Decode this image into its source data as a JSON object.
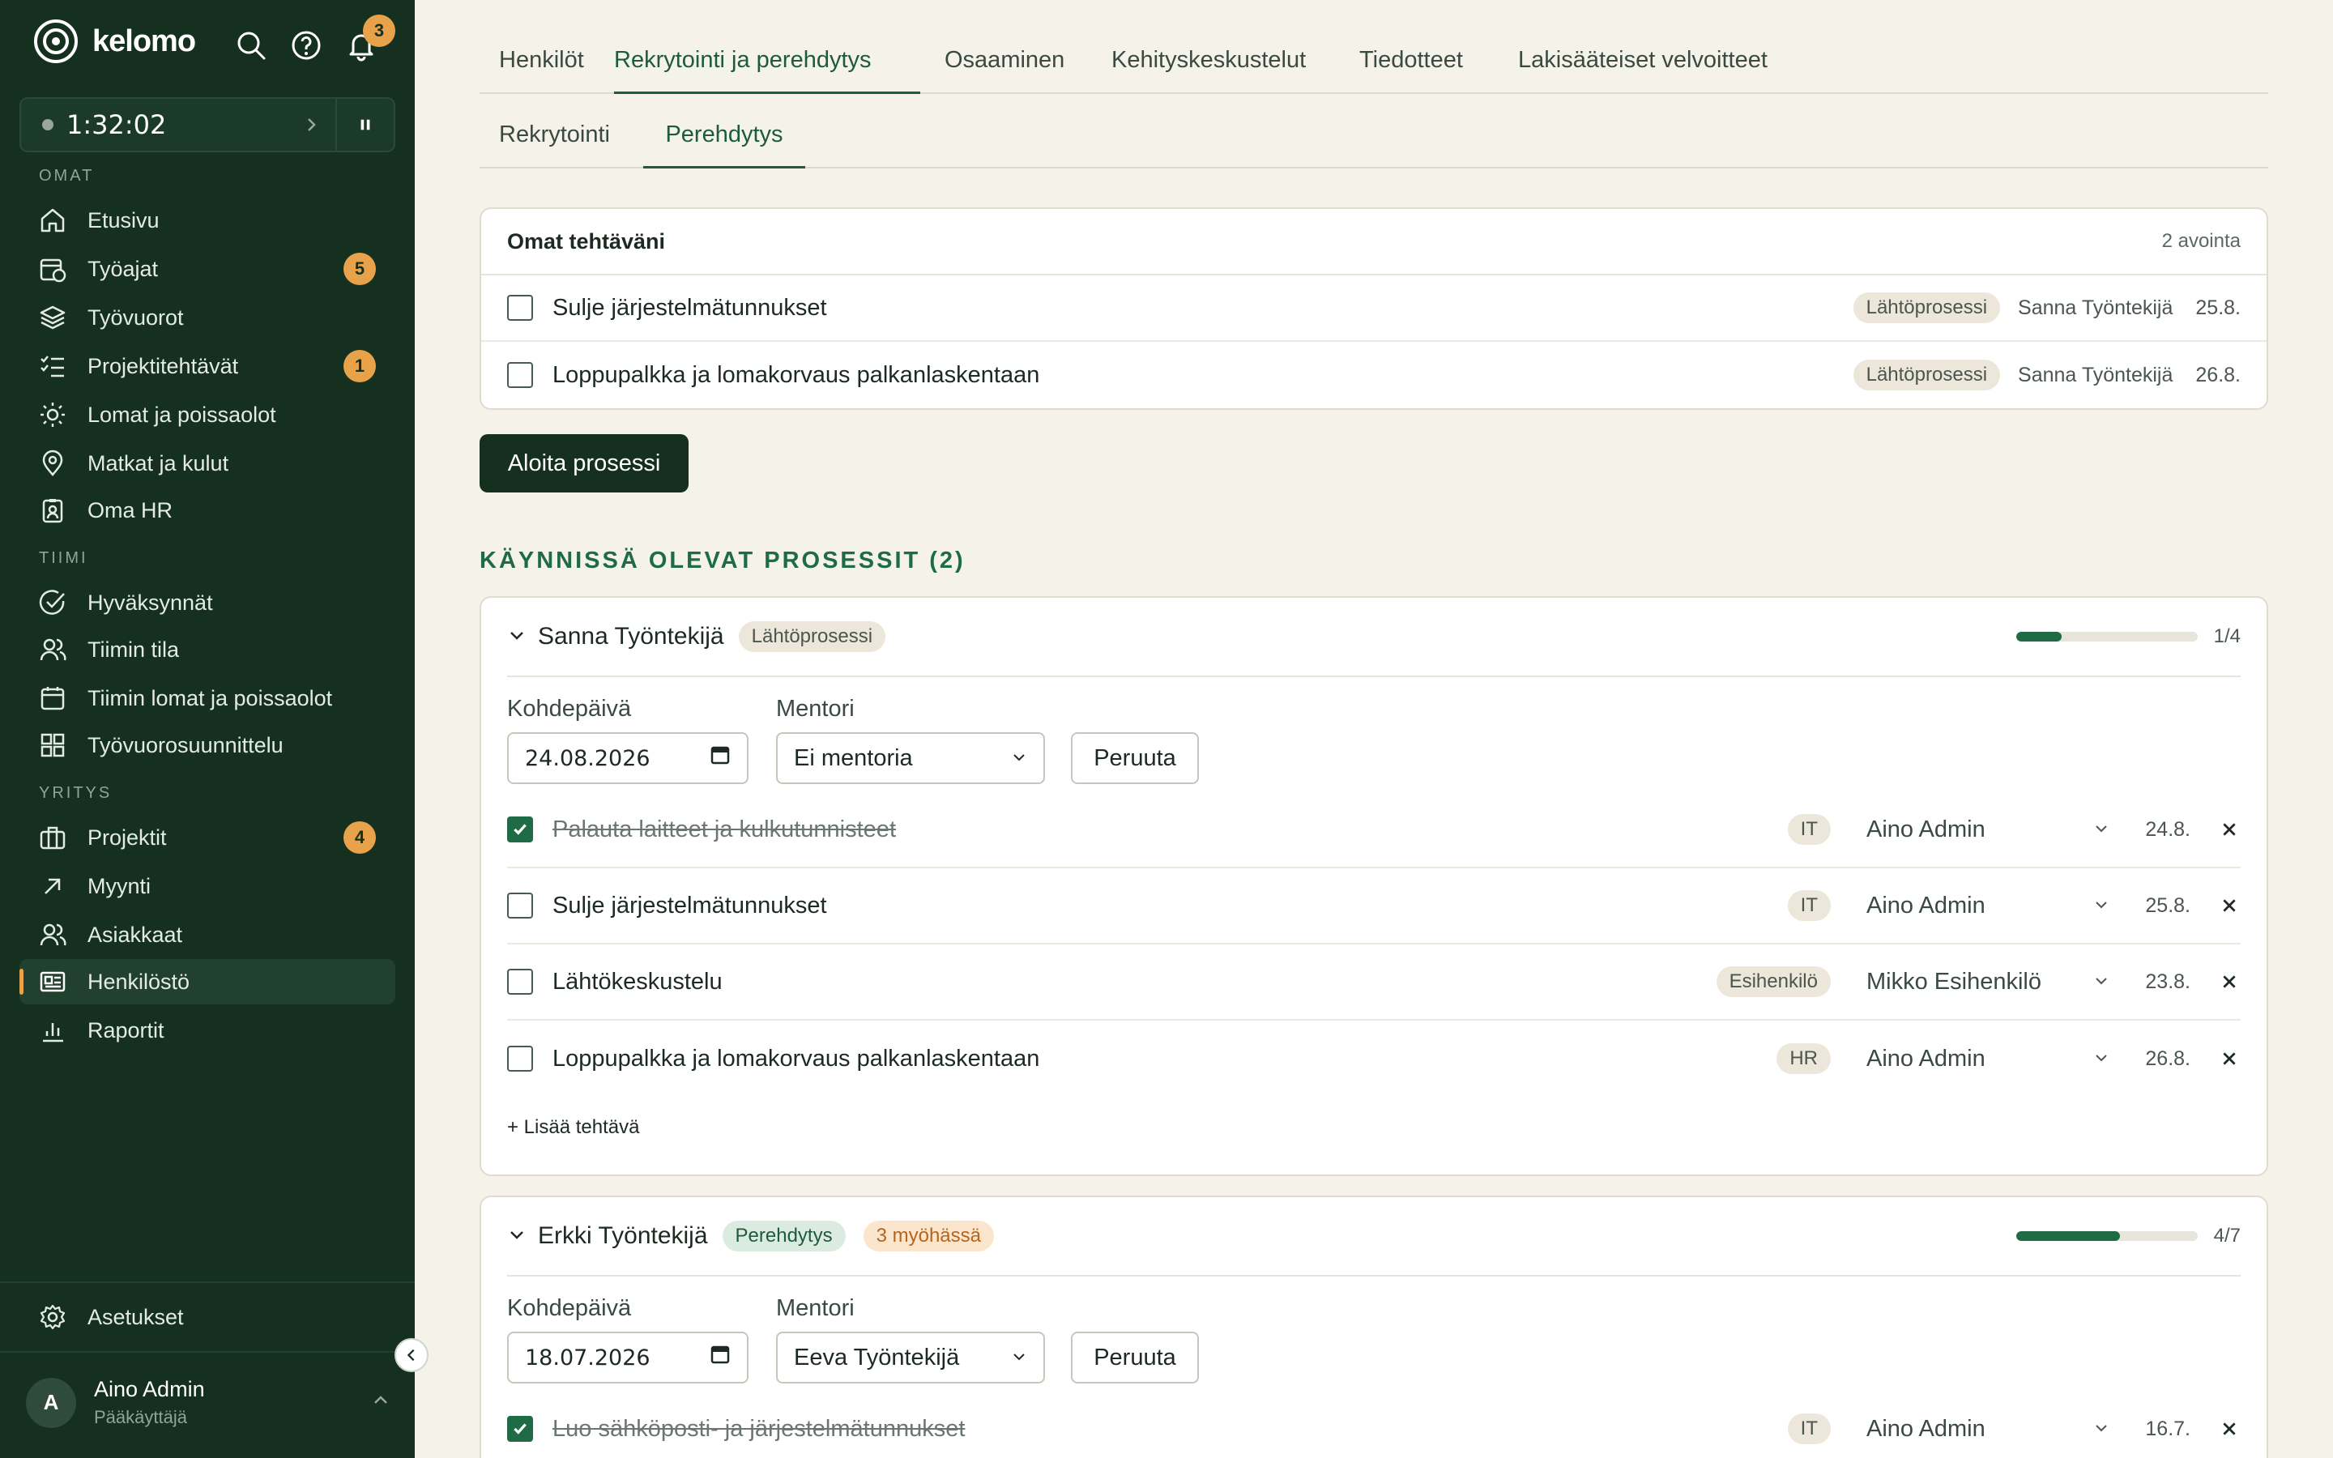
{
  "brand": {
    "name": "kelomo",
    "notification_count": "3"
  },
  "timer": {
    "time": "1:32:02"
  },
  "sidebar": {
    "section_omat": "OMAT",
    "section_tiimi": "TIIMI",
    "section_yritys": "YRITYS",
    "items": [
      {
        "label": "Etusivu",
        "icon": "home-icon"
      },
      {
        "label": "Työajat",
        "icon": "calendar-clock-icon",
        "badge": "5"
      },
      {
        "label": "Työvuorot",
        "icon": "layers-icon"
      },
      {
        "label": "Projektitehtävät",
        "icon": "checklist-icon",
        "badge": "1"
      },
      {
        "label": "Lomat ja poissaolot",
        "icon": "sun-icon"
      },
      {
        "label": "Matkat ja kulut",
        "icon": "map-pin-icon"
      },
      {
        "label": "Oma HR",
        "icon": "badge-icon"
      },
      {
        "label": "Hyväksynnät",
        "icon": "check-circle-icon"
      },
      {
        "label": "Tiimin tila",
        "icon": "users-icon"
      },
      {
        "label": "Tiimin lomat ja poissaolot",
        "icon": "calendar-icon"
      },
      {
        "label": "Työvuorosuunnittelu",
        "icon": "grid-icon"
      },
      {
        "label": "Projektit",
        "icon": "briefcase-icon",
        "badge": "4"
      },
      {
        "label": "Myynti",
        "icon": "arrow-up-right-icon"
      },
      {
        "label": "Asiakkaat",
        "icon": "users-icon"
      },
      {
        "label": "Henkilöstö",
        "icon": "id-card-icon"
      },
      {
        "label": "Raportit",
        "icon": "bar-chart-icon"
      }
    ],
    "settings": "Asetukset",
    "user": {
      "initial": "A",
      "name": "Aino Admin",
      "role": "Pääkäyttäjä"
    }
  },
  "tabs": [
    "Henkilöt",
    "Rekrytointi ja perehdytys",
    "Osaaminen",
    "Kehityskeskustelut",
    "Tiedotteet",
    "Lakisääteiset velvoitteet"
  ],
  "subtabs": [
    "Rekrytointi",
    "Perehdytys"
  ],
  "my_tasks": {
    "title": "Omat tehtäväni",
    "count": "2 avointa",
    "rows": [
      {
        "label": "Sulje järjestelmätunnukset",
        "tag": "Lähtöprosessi",
        "who": "Sanna Työntekijä",
        "date": "25.8."
      },
      {
        "label": "Loppupalkka ja lomakorvaus palkanlaskentaan",
        "tag": "Lähtöprosessi",
        "who": "Sanna Työntekijä",
        "date": "26.8."
      }
    ]
  },
  "start_button": "Aloita prosessi",
  "running_heading": "KÄYNNISSÄ OLEVAT PROSESSIT (2)",
  "processes": [
    {
      "name": "Sanna Työntekijä",
      "type": "Lähtöprosessi",
      "progress": "1/4",
      "progress_fraction": 0.25,
      "date_label": "Kohdepäivä",
      "date_value": "24.08.2026",
      "mentor_label": "Mentori",
      "mentor_value": "Ei mentoria",
      "cancel": "Peruuta",
      "tasks": [
        {
          "label": "Palauta laitteet ja kulkutunnisteet",
          "done": true,
          "tag": "IT",
          "assignee": "Aino Admin",
          "date": "24.8."
        },
        {
          "label": "Sulje järjestelmätunnukset",
          "done": false,
          "tag": "IT",
          "assignee": "Aino Admin",
          "date": "25.8."
        },
        {
          "label": "Lähtökeskustelu",
          "done": false,
          "tag": "Esihenkilö",
          "assignee": "Mikko Esihenkilö",
          "date": "23.8."
        },
        {
          "label": "Loppupalkka ja lomakorvaus palkanlaskentaan",
          "done": false,
          "tag": "HR",
          "assignee": "Aino Admin",
          "date": "26.8."
        }
      ],
      "add_task": "+ Lisää tehtävä"
    },
    {
      "name": "Erkki Työntekijä",
      "type": "Perehdytys",
      "late": "3 myöhässä",
      "progress": "4/7",
      "progress_fraction": 0.571,
      "date_label": "Kohdepäivä",
      "date_value": "18.07.2026",
      "mentor_label": "Mentori",
      "mentor_value": "Eeva Työntekijä",
      "cancel": "Peruuta",
      "tasks": [
        {
          "label": "Luo sähköposti- ja järjestelmätunnukset",
          "done": true,
          "tag": "IT",
          "assignee": "Aino Admin",
          "date": "16.7."
        }
      ]
    }
  ],
  "colors": {
    "sidebar_bg": "#15301f",
    "accent": "#1e6b45",
    "badge": "#e8a34a",
    "page_bg": "#f5f2ea"
  }
}
